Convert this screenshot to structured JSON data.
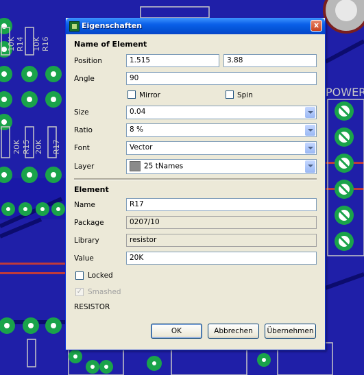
{
  "window": {
    "title": "Eigenschaften",
    "close_label": "x"
  },
  "name_section": {
    "heading": "Name of Element",
    "position_label": "Position",
    "position_x": "1.515",
    "position_y": "3.88",
    "angle_label": "Angle",
    "angle_value": "90",
    "mirror_label": "Mirror",
    "spin_label": "Spin",
    "size_label": "Size",
    "size_value": "0.04",
    "ratio_label": "Ratio",
    "ratio_value": "8 %",
    "font_label": "Font",
    "font_value": "Vector",
    "layer_label": "Layer",
    "layer_value": "25 tNames",
    "layer_color": "#8a8a8a"
  },
  "element_section": {
    "heading": "Element",
    "name_label": "Name",
    "name_value": "R17",
    "package_label": "Package",
    "package_value": "0207/10",
    "library_label": "Library",
    "library_value": "resistor",
    "value_label": "Value",
    "value_value": "20K",
    "locked_label": "Locked",
    "smashed_label": "Smashed",
    "smashed_check": "✓",
    "description": "RESISTOR"
  },
  "buttons": {
    "ok": "OK",
    "cancel": "Abbrechen",
    "apply": "Übernehmen"
  },
  "background": {
    "board_color": "#1f1fa8",
    "pad_color": "#1aa34a",
    "header_label": "POWER",
    "parts": [
      {
        "value": "10K",
        "name": "R14"
      },
      {
        "value": "10K",
        "name": "R16"
      },
      {
        "value": "20K",
        "name": "R15"
      },
      {
        "value": "20K",
        "name": "R17"
      }
    ]
  }
}
